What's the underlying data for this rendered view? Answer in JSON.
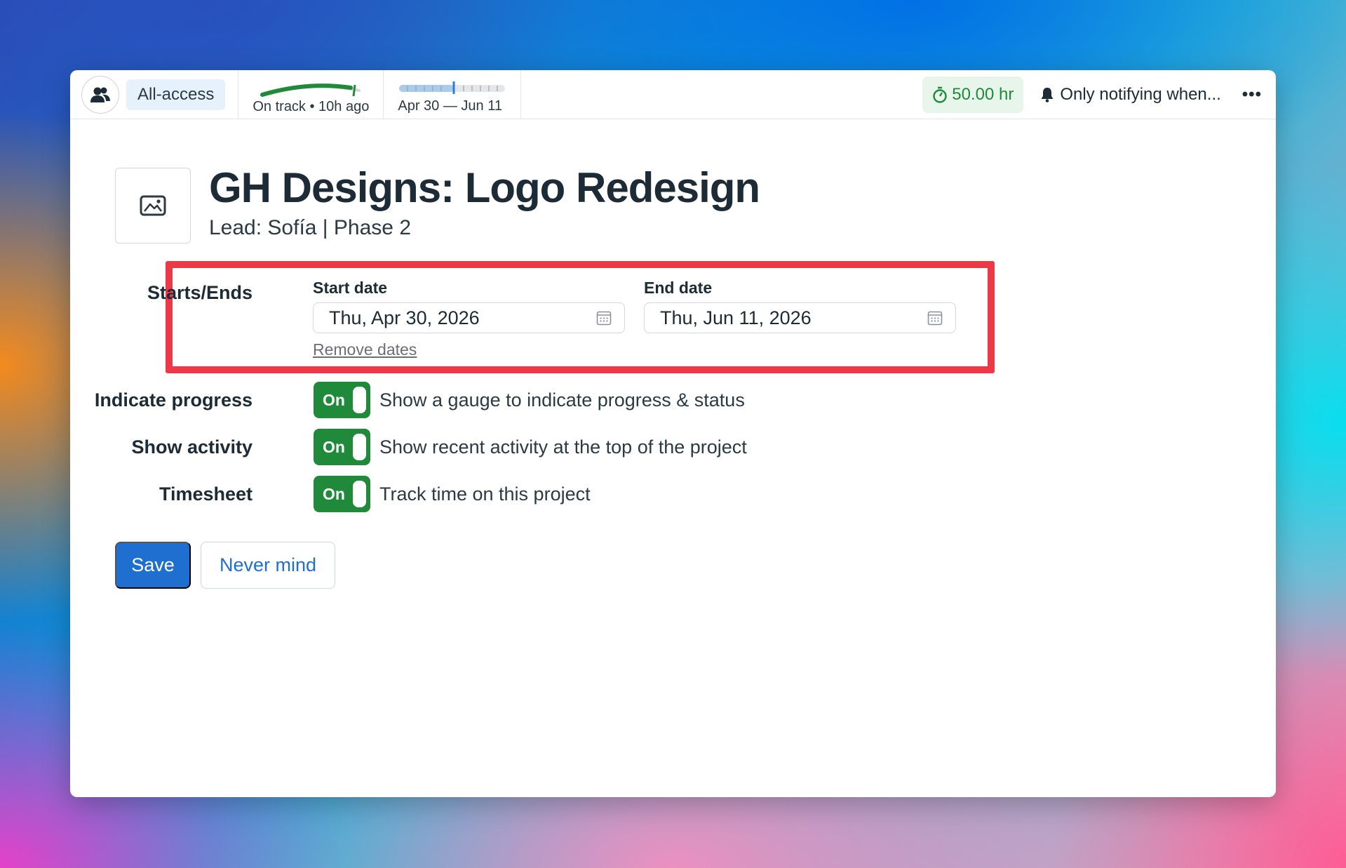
{
  "topbar": {
    "people_icon": "people-icon",
    "access_label": "All-access",
    "progress_status": "On track • 10h ago",
    "progress_value": 0.9,
    "date_range": "Apr 30 — Jun 11",
    "timeline_progress": 0.52,
    "hours": "50.00 hr",
    "notify_label": "Only notifying when...",
    "more_label": "•••"
  },
  "project": {
    "thumbnail_icon": "image-icon",
    "title": "GH Designs: Logo Redesign",
    "subtitle": "Lead: Sofía | Phase 2"
  },
  "dates": {
    "row_label": "Starts/Ends",
    "start_label": "Start date",
    "start_value": "Thu, Apr 30, 2026",
    "end_label": "End date",
    "end_value": "Thu, Jun 11, 2026",
    "remove_label": "Remove dates"
  },
  "settings": [
    {
      "label": "Indicate progress",
      "state": "On",
      "description": "Show a gauge to indicate progress & status"
    },
    {
      "label": "Show activity",
      "state": "On",
      "description": "Show recent activity at the top of the project"
    },
    {
      "label": "Timesheet",
      "state": "On",
      "description": "Track time on this project"
    }
  ],
  "actions": {
    "save_label": "Save",
    "cancel_label": "Never mind"
  },
  "colors": {
    "accent_blue": "#1f6fd0",
    "toggle_green": "#1f8a3a",
    "highlight_red": "#ee3747"
  }
}
